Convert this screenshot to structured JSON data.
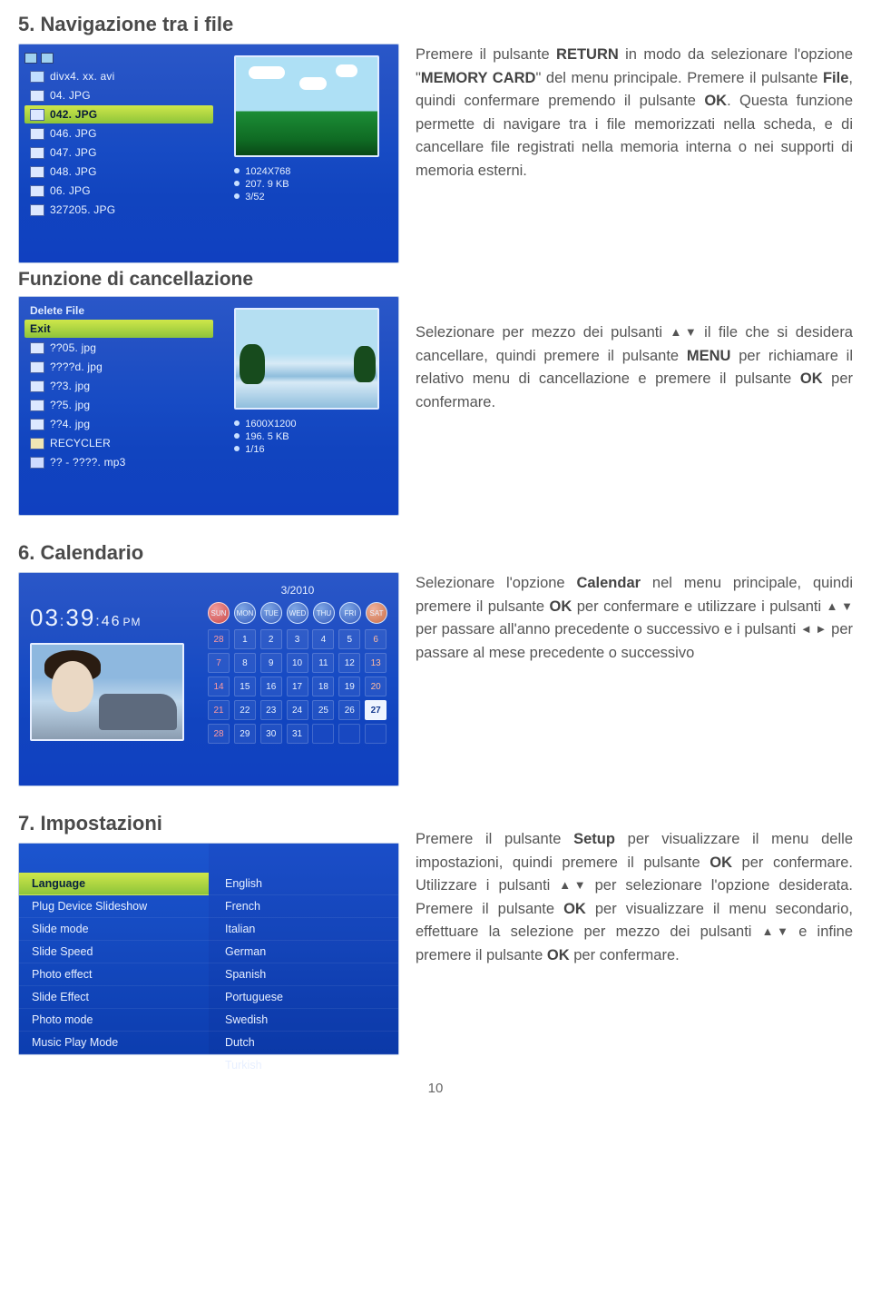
{
  "page_number": "10",
  "section5": {
    "title": "5. Navigazione tra i file",
    "subtitle": "Funzione di cancellazione",
    "para1_pre": "Premere il pulsante ",
    "b_return": "RETURN",
    "para1_mid1": " in modo da selezionare l'opzione \"",
    "b_memory": "MEMORY CARD",
    "para1_mid2": "\" del menu principale. Premere il pulsante ",
    "b_file": "File",
    "para1_mid3": ", quindi confermare premendo il pulsante ",
    "b_ok1": "OK",
    "para1_tail": ". Questa funzione permette di navigare tra i file memorizzati nella scheda, e di cancellare file registrati nella memoria interna o nei supporti di memoria esterni.",
    "para2_pre": "Selezionare per mezzo dei pulsanti ",
    "para2_mid1": " il file che si desidera cancellare, quindi premere il pulsante ",
    "b_menu": "MENU",
    "para2_mid2": " per richiamare il relativo menu di cancellazione e premere il pulsante ",
    "b_ok2": "OK",
    "para2_tail": " per confermare."
  },
  "section6": {
    "title": "6. Calendario",
    "p_pre": "Selezionare l'opzione ",
    "b_cal": "Calendar",
    "p_mid1": " nel menu principale, quindi premere il pulsante ",
    "b_ok": "OK",
    "p_mid2": " per confermare e utilizzare i pulsanti ",
    "p_mid3": " per passare all'anno precedente o successivo e i pulsanti ",
    "p_tail": " per passare al mese precedente o successivo"
  },
  "section7": {
    "title": "7. Impostazioni",
    "p_pre": "Premere il pulsante ",
    "b_setup": "Setup",
    "p_mid1": " per visualizzare il menu delle impostazioni, quindi premere il pulsante ",
    "b_ok1": "OK",
    "p_mid2": " per confermare. Utilizzare i pulsanti ",
    "p_mid3": " per selezionare l'opzione desiderata. Premere il pulsante ",
    "b_ok2": "OK",
    "p_mid4": " per visualizzare il menu secondario, effettuare la selezione per mezzo dei pulsanti ",
    "p_mid5": " e infine premere il pulsante ",
    "b_ok3": "OK",
    "p_tail": " per confermare."
  },
  "file_panel1": {
    "items": [
      {
        "label": "divx4. xx. avi",
        "cls": "movie"
      },
      {
        "label": "04. JPG",
        "cls": ""
      },
      {
        "label": "042. JPG",
        "cls": "",
        "sel": true
      },
      {
        "label": "046. JPG",
        "cls": ""
      },
      {
        "label": "047. JPG",
        "cls": ""
      },
      {
        "label": "048. JPG",
        "cls": ""
      },
      {
        "label": "06. JPG",
        "cls": ""
      },
      {
        "label": "327205. JPG",
        "cls": ""
      }
    ],
    "meta": {
      "res": "1024X768",
      "size": "207. 9 KB",
      "index": "3/52"
    }
  },
  "file_panel2": {
    "header": "Delete File",
    "exit": "Exit",
    "items": [
      {
        "label": "??05. jpg",
        "cls": ""
      },
      {
        "label": "????d. jpg",
        "cls": ""
      },
      {
        "label": "??3. jpg",
        "cls": ""
      },
      {
        "label": "??5. jpg",
        "cls": ""
      },
      {
        "label": "??4. jpg",
        "cls": ""
      },
      {
        "label": "RECYCLER",
        "cls": "folder"
      },
      {
        "label": "?? - ????. mp3",
        "cls": "music"
      }
    ],
    "meta": {
      "res": "1600X1200",
      "size": "196. 5 KB",
      "index": "1/16"
    }
  },
  "calendar_panel": {
    "month_year": "3/2010",
    "clock_h": "03",
    "clock_m": "39",
    "clock_s": "46",
    "ampm": "PM",
    "dow": [
      {
        "t": "SUN",
        "c": "sun"
      },
      {
        "t": "MON",
        "c": ""
      },
      {
        "t": "TUE",
        "c": ""
      },
      {
        "t": "WED",
        "c": ""
      },
      {
        "t": "THU",
        "c": ""
      },
      {
        "t": "FRI",
        "c": ""
      },
      {
        "t": "SAT",
        "c": "sat"
      }
    ],
    "cells": [
      {
        "n": "28",
        "c": "prev sun"
      },
      {
        "n": "1",
        "c": ""
      },
      {
        "n": "2",
        "c": ""
      },
      {
        "n": "3",
        "c": ""
      },
      {
        "n": "4",
        "c": ""
      },
      {
        "n": "5",
        "c": ""
      },
      {
        "n": "6",
        "c": "sat"
      },
      {
        "n": "7",
        "c": "sun"
      },
      {
        "n": "8",
        "c": ""
      },
      {
        "n": "9",
        "c": ""
      },
      {
        "n": "10",
        "c": ""
      },
      {
        "n": "11",
        "c": ""
      },
      {
        "n": "12",
        "c": ""
      },
      {
        "n": "13",
        "c": "sat"
      },
      {
        "n": "14",
        "c": "sun"
      },
      {
        "n": "15",
        "c": ""
      },
      {
        "n": "16",
        "c": ""
      },
      {
        "n": "17",
        "c": ""
      },
      {
        "n": "18",
        "c": ""
      },
      {
        "n": "19",
        "c": ""
      },
      {
        "n": "20",
        "c": "sat"
      },
      {
        "n": "21",
        "c": "sun"
      },
      {
        "n": "22",
        "c": ""
      },
      {
        "n": "23",
        "c": ""
      },
      {
        "n": "24",
        "c": ""
      },
      {
        "n": "25",
        "c": ""
      },
      {
        "n": "26",
        "c": ""
      },
      {
        "n": "27",
        "c": "sat today"
      },
      {
        "n": "28",
        "c": "sun"
      },
      {
        "n": "29",
        "c": ""
      },
      {
        "n": "30",
        "c": ""
      },
      {
        "n": "31",
        "c": ""
      },
      {
        "n": "",
        "c": "next"
      },
      {
        "n": "",
        "c": "next"
      },
      {
        "n": "",
        "c": "next"
      }
    ]
  },
  "settings_panel": {
    "left": [
      {
        "label": "Language",
        "sel": true
      },
      {
        "label": "Plug Device Slideshow"
      },
      {
        "label": "Slide mode"
      },
      {
        "label": "Slide Speed"
      },
      {
        "label": "Photo effect"
      },
      {
        "label": "Slide Effect"
      },
      {
        "label": "Photo mode"
      },
      {
        "label": "Music Play Mode"
      }
    ],
    "right": [
      {
        "label": "English"
      },
      {
        "label": "French"
      },
      {
        "label": "Italian"
      },
      {
        "label": "German"
      },
      {
        "label": "Spanish"
      },
      {
        "label": "Portuguese"
      },
      {
        "label": "Swedish"
      },
      {
        "label": "Dutch"
      },
      {
        "label": "Turkish"
      }
    ]
  }
}
